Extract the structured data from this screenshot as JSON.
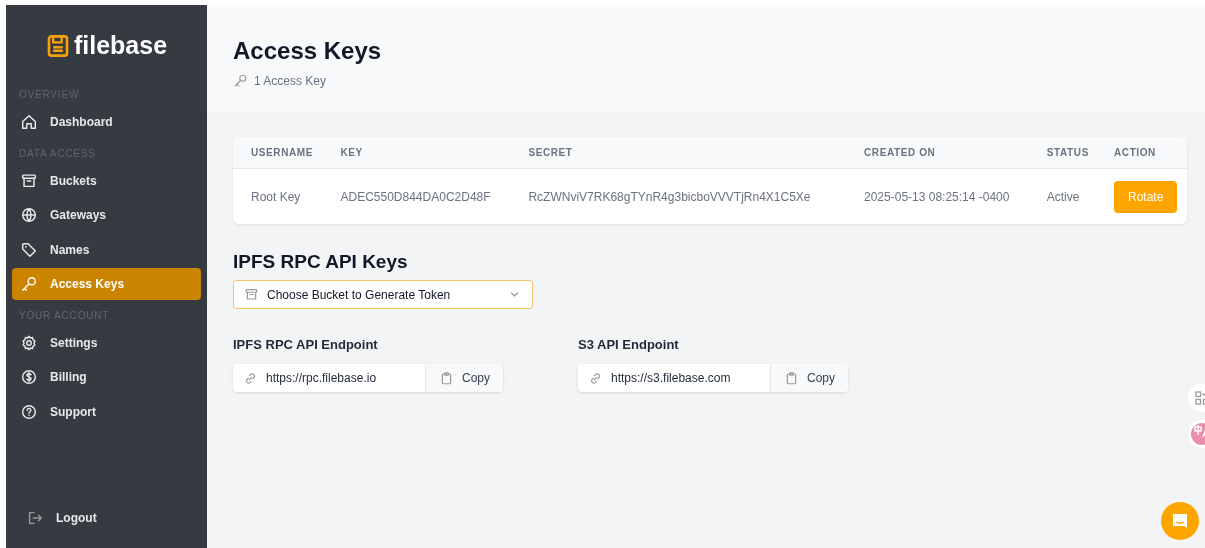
{
  "sidebar": {
    "logo": "filebase",
    "sections": [
      {
        "heading": "OVERVIEW",
        "items": [
          {
            "label": "Dashboard",
            "selected": false
          }
        ]
      },
      {
        "heading": "DATA ACCESS",
        "items": [
          {
            "label": "Buckets",
            "selected": false
          },
          {
            "label": "Gateways",
            "selected": false
          },
          {
            "label": "Names",
            "selected": false
          },
          {
            "label": "Access Keys",
            "selected": true
          }
        ]
      },
      {
        "heading": "YOUR ACCOUNT",
        "items": [
          {
            "label": "Settings",
            "selected": false
          },
          {
            "label": "Billing",
            "selected": false
          },
          {
            "label": "Support",
            "selected": false
          }
        ]
      }
    ],
    "logout": "Logout"
  },
  "header": {
    "title": "Access Keys",
    "subtitle": "1 Access Key"
  },
  "table": {
    "columns": [
      "USERNAME",
      "KEY",
      "SECRET",
      "CREATED ON",
      "STATUS",
      "ACTION"
    ],
    "rows": [
      {
        "username": "Root Key",
        "key": "ADEC550D844DA0C2D48F",
        "secret": "RcZWNviV7RK68gTYnR4g3bicboVVVTjRn4X1C5Xe",
        "created_on": "2025-05-13 08:25:14 -0400",
        "status": "Active",
        "action": "Rotate"
      }
    ]
  },
  "ipfs": {
    "title": "IPFS RPC API Keys",
    "dropdown": {
      "placeholder": "Choose Bucket to Generate Token"
    }
  },
  "endpoints": [
    {
      "label": "IPFS RPC API Endpoint",
      "value": "https://rpc.filebase.io",
      "button": "Copy"
    },
    {
      "label": "S3 API Endpoint",
      "value": "https://s3.filebase.com",
      "button": "Copy"
    }
  ]
}
